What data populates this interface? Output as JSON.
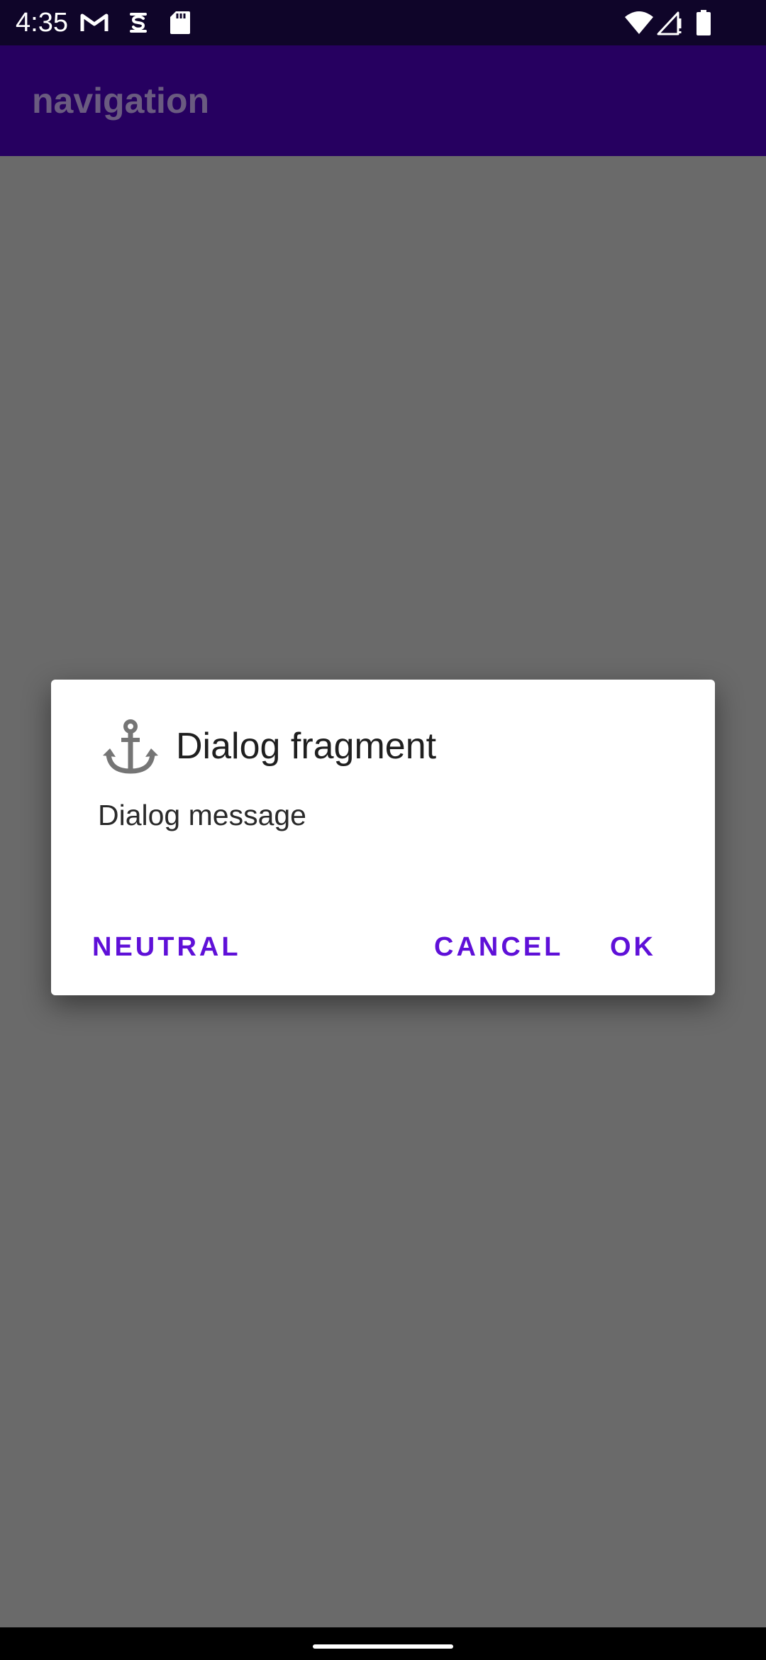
{
  "status_bar": {
    "time": "4:35",
    "icons": [
      "gmail-icon",
      "sim-icon",
      "sd-card-icon",
      "wifi-icon",
      "signal-icon",
      "battery-icon"
    ]
  },
  "app_bar": {
    "title": "navigation"
  },
  "dialog": {
    "icon": "anchor-icon",
    "title": "Dialog fragment",
    "message": "Dialog message",
    "buttons": {
      "neutral": "NEUTRAL",
      "cancel": "CANCEL",
      "ok": "OK"
    }
  },
  "colors": {
    "status_bar": "#0f0529",
    "app_bar": "#260060",
    "scrim": "#6a6a6a",
    "accent": "#5f10d8",
    "dialog_bg": "#ffffff",
    "icon_gray": "#757575"
  }
}
